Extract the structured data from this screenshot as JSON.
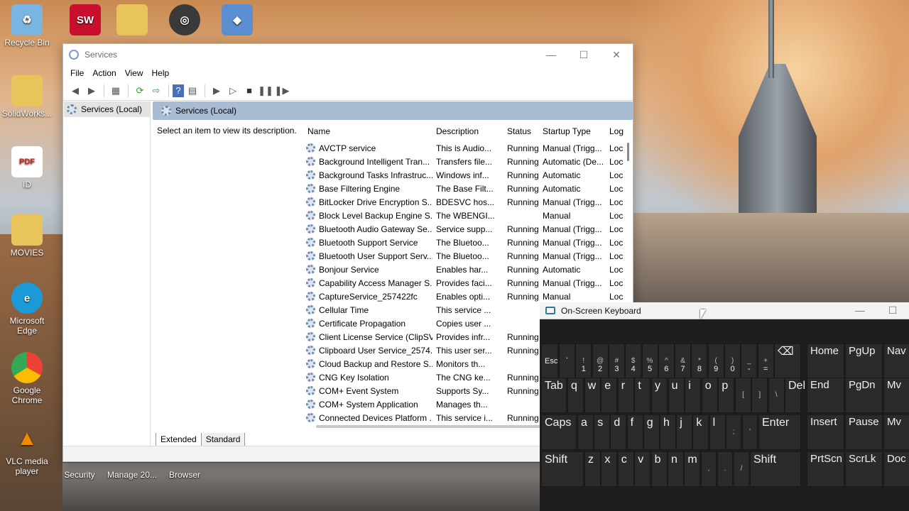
{
  "desktop": {
    "icons": [
      {
        "label": "Recycle Bin",
        "glyph": "recycle-bin-icon",
        "color": "#7ab4e0"
      },
      {
        "label": "SW 2023",
        "glyph": "solidworks-icon",
        "color": "#c8102e"
      },
      {
        "label": "SolidWorks...",
        "glyph": "folder-icon",
        "color": "#e8c45a"
      },
      {
        "label": "ID",
        "glyph": "pdf-icon",
        "color": "#d9261c"
      },
      {
        "label": "MOVIES",
        "glyph": "folder-icon",
        "color": "#e8c45a"
      },
      {
        "label": "Microsoft Edge",
        "glyph": "edge-icon",
        "color": "#1a9bd7"
      },
      {
        "label": "Google Chrome",
        "glyph": "chrome-icon",
        "color": "#34a853"
      },
      {
        "label": "VLC media player",
        "glyph": "vlc-icon",
        "color": "#f08a00"
      }
    ],
    "bottom_labels": [
      "Security",
      "Manage 20...",
      "Browser"
    ]
  },
  "services": {
    "title": "Services",
    "menu": [
      "File",
      "Action",
      "View",
      "Help"
    ],
    "tree_item": "Services (Local)",
    "header": "Services (Local)",
    "description_prompt": "Select an item to view its description.",
    "columns": [
      "Name",
      "Description",
      "Status",
      "Startup Type",
      "Log"
    ],
    "rows": [
      [
        "AVCTP service",
        "This is Audio...",
        "Running",
        "Manual (Trigg...",
        "Loc"
      ],
      [
        "Background Intelligent Tran...",
        "Transfers file...",
        "Running",
        "Automatic (De...",
        "Loc"
      ],
      [
        "Background Tasks Infrastruc...",
        "Windows inf...",
        "Running",
        "Automatic",
        "Loc"
      ],
      [
        "Base Filtering Engine",
        "The Base Filt...",
        "Running",
        "Automatic",
        "Loc"
      ],
      [
        "BitLocker Drive Encryption S...",
        "BDESVC hos...",
        "Running",
        "Manual (Trigg...",
        "Loc"
      ],
      [
        "Block Level Backup Engine S...",
        "The WBENGI...",
        "",
        "Manual",
        "Loc"
      ],
      [
        "Bluetooth Audio Gateway Se...",
        "Service supp...",
        "Running",
        "Manual (Trigg...",
        "Loc"
      ],
      [
        "Bluetooth Support Service",
        "The Bluetoo...",
        "Running",
        "Manual (Trigg...",
        "Loc"
      ],
      [
        "Bluetooth User Support Serv...",
        "The Bluetoo...",
        "Running",
        "Manual (Trigg...",
        "Loc"
      ],
      [
        "Bonjour Service",
        "Enables har...",
        "Running",
        "Automatic",
        "Loc"
      ],
      [
        "Capability Access Manager S...",
        "Provides faci...",
        "Running",
        "Manual (Trigg...",
        "Loc"
      ],
      [
        "CaptureService_257422fc",
        "Enables opti...",
        "Running",
        "Manual",
        "Loc"
      ],
      [
        "Cellular Time",
        "This service ...",
        "",
        "",
        ""
      ],
      [
        "Certificate Propagation",
        "Copies user ...",
        "",
        "",
        ""
      ],
      [
        "Client License Service (ClipSV...",
        "Provides infr...",
        "Running",
        "",
        ""
      ],
      [
        "Clipboard User Service_2574...",
        "This user ser...",
        "Running",
        "",
        ""
      ],
      [
        "Cloud Backup and Restore S...",
        "Monitors th...",
        "",
        "",
        ""
      ],
      [
        "CNG Key Isolation",
        "The CNG ke...",
        "Running",
        "",
        ""
      ],
      [
        "COM+ Event System",
        "Supports Sy...",
        "Running",
        "",
        ""
      ],
      [
        "COM+ System Application",
        "Manages th...",
        "",
        "",
        ""
      ],
      [
        "Connected Devices Platform ...",
        "This service i...",
        "Running",
        "",
        ""
      ]
    ],
    "tabs": [
      "Extended",
      "Standard"
    ]
  },
  "osk": {
    "title": "On-Screen Keyboard",
    "row1_top": [
      "",
      "!",
      "@",
      "#",
      "$",
      "%",
      "^",
      "&",
      "*",
      "(",
      ")",
      "_",
      "+"
    ],
    "row1": [
      "`",
      "1",
      "2",
      "3",
      "4",
      "5",
      "6",
      "7",
      "8",
      "9",
      "0",
      "-",
      "="
    ],
    "esc": "Esc",
    "row2": [
      "Tab",
      "q",
      "w",
      "e",
      "r",
      "t",
      "y",
      "u",
      "i",
      "o",
      "p",
      "[",
      "]",
      "\\",
      "Del"
    ],
    "row3": [
      "Caps",
      "a",
      "s",
      "d",
      "f",
      "g",
      "h",
      "j",
      "k",
      "l",
      ";",
      "'",
      "Enter"
    ],
    "row4": [
      "Shift",
      "z",
      "x",
      "c",
      "v",
      "b",
      "n",
      "m",
      ",",
      ".",
      "/",
      "Shift"
    ],
    "side": [
      "Home",
      "PgUp",
      "Nav",
      "End",
      "PgDn",
      "Mv",
      "Insert",
      "Pause",
      "Mv",
      "PrtScn",
      "ScrLk",
      "Doc"
    ]
  }
}
